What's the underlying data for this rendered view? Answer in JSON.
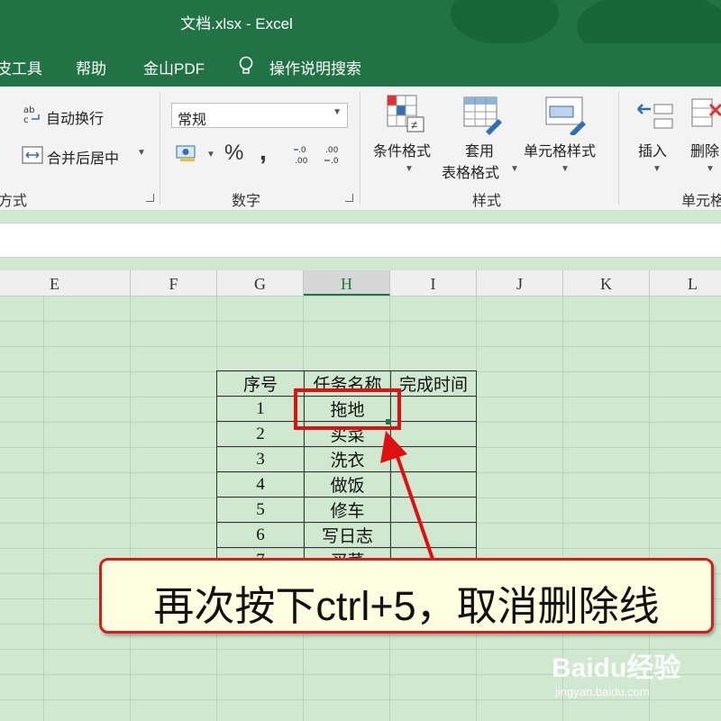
{
  "window": {
    "title": "文档.xlsx  -  Excel"
  },
  "menu": [
    "皮工具",
    "帮助",
    "金山PDF",
    "操作说明搜索"
  ],
  "ribbon": {
    "alignment": {
      "wrap_label": "自动换行",
      "merge_label": "合并后居中",
      "group_label": "齐方式"
    },
    "number": {
      "format_value": "常规",
      "group_label": "数字"
    },
    "styles": {
      "conditional": "条件格式",
      "table_format_line1": "套用",
      "table_format_line2": "表格格式",
      "cell_style": "单元格样式",
      "group_label": "样式"
    },
    "cells": {
      "insert": "插入",
      "delete": "删除",
      "group_label": "单元格"
    }
  },
  "columns": [
    "E",
    "F",
    "G",
    "H",
    "I",
    "J",
    "K",
    "L"
  ],
  "selected_column": "H",
  "table": {
    "headers": [
      "序号",
      "任务名称",
      "完成时间"
    ],
    "rows": [
      [
        "1",
        "拖地",
        ""
      ],
      [
        "2",
        "买菜",
        ""
      ],
      [
        "3",
        "洗衣",
        ""
      ],
      [
        "4",
        "做饭",
        ""
      ],
      [
        "5",
        "修车",
        ""
      ],
      [
        "6",
        "写日志",
        ""
      ],
      [
        "7",
        "买菜",
        ""
      ]
    ]
  },
  "callout_text": "再次按下ctrl+5，取消删除线",
  "watermark": {
    "brand": "Baidu经验",
    "url": "jingyan.baidu.com"
  },
  "colors": {
    "excel_green": "#217346",
    "sheet_bg": "#cfe8cf",
    "annotation_red": "#e01010"
  }
}
